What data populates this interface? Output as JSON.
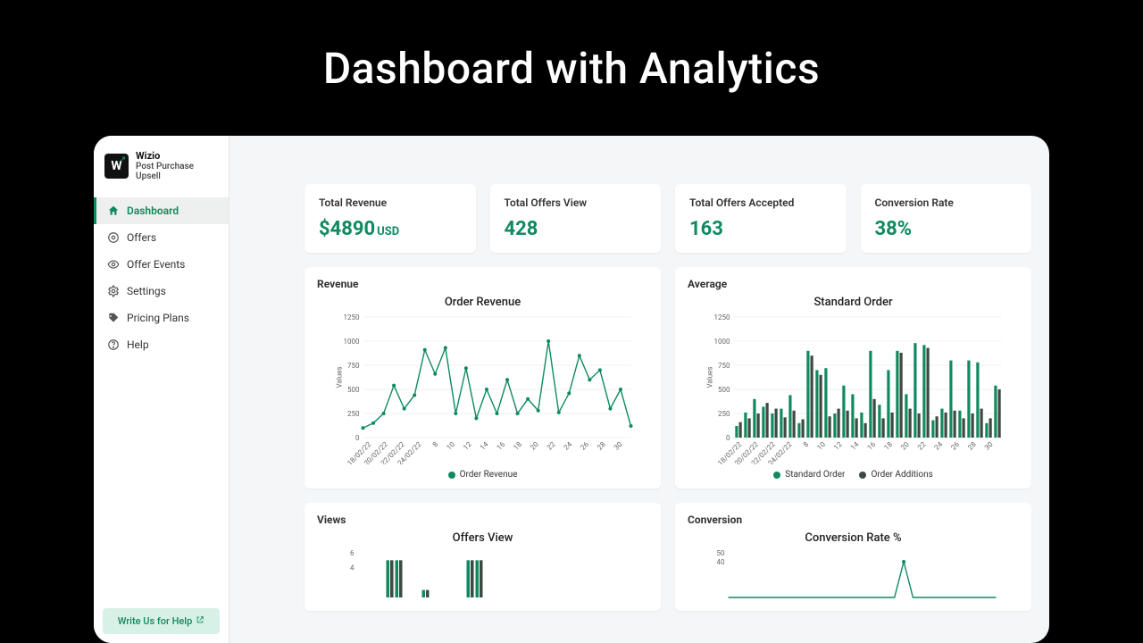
{
  "hero_title": "Dashboard with Analytics",
  "brand": {
    "logo_letter": "W",
    "name": "Wizio",
    "subtitle": "Post Purchase Upsell"
  },
  "sidebar": {
    "items": [
      {
        "label": "Dashboard",
        "icon": "home-icon",
        "active": true
      },
      {
        "label": "Offers",
        "icon": "tag-icon",
        "active": false
      },
      {
        "label": "Offer Events",
        "icon": "eye-icon",
        "active": false
      },
      {
        "label": "Settings",
        "icon": "gear-icon",
        "active": false
      },
      {
        "label": "Pricing Plans",
        "icon": "pricetag-icon",
        "active": false
      },
      {
        "label": "Help",
        "icon": "help-icon",
        "active": false
      }
    ],
    "help_button": "Write Us for Help"
  },
  "stats": [
    {
      "label": "Total Revenue",
      "value": "$4890",
      "suffix": "USD"
    },
    {
      "label": "Total Offers View",
      "value": "428",
      "suffix": ""
    },
    {
      "label": "Total Offers Accepted",
      "value": "163",
      "suffix": ""
    },
    {
      "label": "Conversion Rate",
      "value": "38%",
      "suffix": ""
    }
  ],
  "chart_common": {
    "ylabel": "Values",
    "yticks": [
      0,
      250,
      500,
      750,
      1000,
      1250
    ],
    "xlabels": [
      "18/02/22",
      "20/02/22",
      "22/02/22",
      "24/02/22",
      "8",
      "10",
      "12",
      "14",
      "16",
      "18",
      "20",
      "22",
      "24",
      "26",
      "28",
      "30"
    ]
  },
  "chart_data": [
    {
      "id": "revenue_chart",
      "type": "line",
      "section": "Revenue",
      "title": "Order Revenue",
      "legend": [
        "Order Revenue"
      ],
      "ylim": [
        0,
        1250
      ],
      "series": [
        {
          "name": "Order Revenue",
          "values": [
            100,
            150,
            250,
            540,
            300,
            440,
            910,
            660,
            930,
            250,
            720,
            200,
            500,
            250,
            600,
            250,
            400,
            280,
            1000,
            260,
            460,
            850,
            600,
            700,
            300,
            500,
            120
          ]
        }
      ]
    },
    {
      "id": "average_chart",
      "type": "bar",
      "section": "Average",
      "title": "Standard Order",
      "legend": [
        "Standard Order",
        "Order Additions"
      ],
      "ylim": [
        0,
        1250
      ],
      "series": [
        {
          "name": "Standard Order",
          "values": [
            120,
            260,
            400,
            320,
            250,
            300,
            440,
            150,
            900,
            700,
            720,
            250,
            540,
            450,
            260,
            900,
            340,
            700,
            900,
            450,
            980,
            960,
            180,
            300,
            800,
            280,
            800,
            780,
            150,
            540
          ]
        },
        {
          "name": "Order Additions",
          "values": [
            160,
            200,
            250,
            360,
            300,
            210,
            280,
            190,
            850,
            650,
            220,
            300,
            280,
            200,
            150,
            400,
            200,
            260,
            880,
            300,
            250,
            930,
            220,
            260,
            280,
            200,
            250,
            300,
            200,
            500
          ]
        }
      ]
    },
    {
      "id": "views_chart",
      "type": "bar",
      "section": "Views",
      "title": "Offers View",
      "ylim": [
        0,
        6
      ],
      "yticks": [
        4,
        6
      ],
      "series": [
        {
          "name": "Offers View",
          "values": [
            0,
            0,
            0,
            5,
            5,
            0,
            0,
            1,
            0,
            0,
            0,
            0,
            5,
            5,
            0,
            0,
            0,
            0,
            0,
            0,
            0,
            0,
            0,
            0,
            0,
            0,
            0,
            0,
            0,
            0
          ]
        }
      ]
    },
    {
      "id": "conversion_chart",
      "type": "line",
      "section": "Conversion",
      "title": "Conversion Rate %",
      "ylim": [
        0,
        50
      ],
      "yticks": [
        40,
        50
      ],
      "series": [
        {
          "name": "Conversion Rate %",
          "values": [
            0,
            0,
            0,
            0,
            0,
            0,
            0,
            0,
            0,
            0,
            0,
            0,
            0,
            0,
            0,
            0,
            0,
            0,
            0,
            40,
            0,
            0,
            0,
            0,
            0,
            0,
            0,
            0,
            0,
            0
          ]
        }
      ]
    }
  ]
}
